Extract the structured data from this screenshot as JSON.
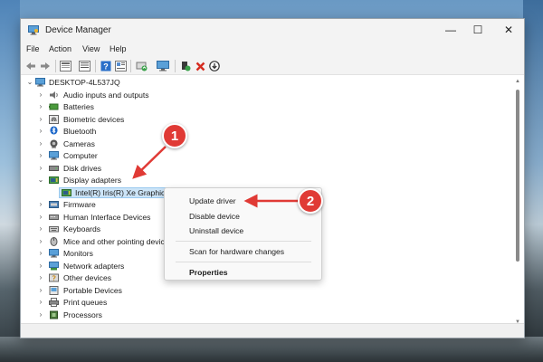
{
  "window": {
    "title": "Device Manager",
    "controls": {
      "minimize": "—",
      "maximize": "☐",
      "close": "✕"
    }
  },
  "menu": [
    {
      "label": "File"
    },
    {
      "label": "Action"
    },
    {
      "label": "View"
    },
    {
      "label": "Help"
    }
  ],
  "toolbar": {
    "buttons": [
      {
        "icon": "back-icon"
      },
      {
        "icon": "forward-icon"
      },
      {
        "icon": "computer-properties-icon"
      },
      {
        "icon": "list-view-icon"
      },
      {
        "icon": "help-icon"
      },
      {
        "icon": "details-icon"
      },
      {
        "icon": "update-driver-icon"
      },
      {
        "icon": "monitor-scan-icon"
      },
      {
        "icon": "enable-device-icon"
      },
      {
        "icon": "uninstall-x-icon"
      },
      {
        "icon": "download-icon"
      }
    ],
    "colors": {
      "uninstall": "#d52b1e",
      "help": "#2a6fc9"
    }
  },
  "tree": {
    "root": "DESKTOP-4L537JQ",
    "items": [
      {
        "label": "Audio inputs and outputs",
        "icon": "speaker-icon",
        "expanded": false
      },
      {
        "label": "Batteries",
        "icon": "battery-icon",
        "expanded": false
      },
      {
        "label": "Biometric devices",
        "icon": "fingerprint-icon",
        "expanded": false
      },
      {
        "label": "Bluetooth",
        "icon": "bluetooth-icon",
        "expanded": false
      },
      {
        "label": "Cameras",
        "icon": "camera-icon",
        "expanded": false
      },
      {
        "label": "Computer",
        "icon": "computer-icon",
        "expanded": false
      },
      {
        "label": "Disk drives",
        "icon": "disk-icon",
        "expanded": false
      },
      {
        "label": "Display adapters",
        "icon": "display-adapter-icon",
        "expanded": true
      },
      {
        "label": "Intel(R) Iris(R) Xe Graphics",
        "icon": "display-adapter-icon",
        "child": true,
        "selected": true
      },
      {
        "label": "Firmware",
        "icon": "firmware-icon",
        "expanded": false
      },
      {
        "label": "Human Interface Devices",
        "icon": "hid-icon",
        "expanded": false
      },
      {
        "label": "Keyboards",
        "icon": "keyboard-icon",
        "expanded": false
      },
      {
        "label": "Mice and other pointing devices",
        "icon": "mouse-icon",
        "expanded": false
      },
      {
        "label": "Monitors",
        "icon": "monitor-icon",
        "expanded": false
      },
      {
        "label": "Network adapters",
        "icon": "network-icon",
        "expanded": false
      },
      {
        "label": "Other devices",
        "icon": "other-devices-icon",
        "expanded": false
      },
      {
        "label": "Portable Devices",
        "icon": "portable-icon",
        "expanded": false
      },
      {
        "label": "Print queues",
        "icon": "printer-icon",
        "expanded": false
      },
      {
        "label": "Processors",
        "icon": "processor-icon",
        "expanded": false
      }
    ]
  },
  "context_menu": {
    "items": [
      {
        "label": "Update driver"
      },
      {
        "label": "Disable device"
      },
      {
        "label": "Uninstall device"
      },
      {
        "label": "Scan for hardware changes"
      },
      {
        "label": "Properties"
      }
    ]
  },
  "annotations": [
    {
      "label": "1",
      "color": "#e03a35"
    },
    {
      "label": "2",
      "color": "#e03a35"
    }
  ]
}
